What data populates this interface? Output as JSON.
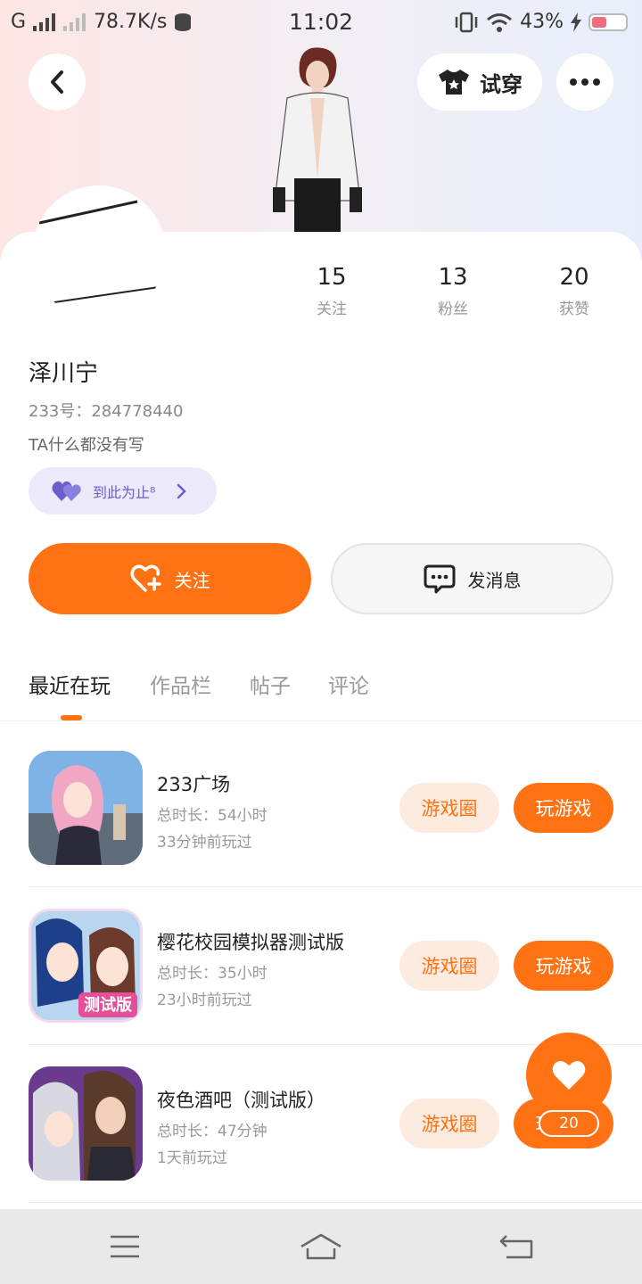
{
  "status_bar": {
    "carrier": "G",
    "net_speed": "78.7K/s",
    "time": "11:02",
    "battery": "43%"
  },
  "header": {
    "back_icon": "chevron-left-icon",
    "try_on_label": "试穿",
    "more_icon": "more-dots-icon"
  },
  "stats": [
    {
      "value": "15",
      "label": "关注"
    },
    {
      "value": "13",
      "label": "粉丝"
    },
    {
      "value": "20",
      "label": "获赞"
    }
  ],
  "profile": {
    "name": "泽川宁",
    "uid": "233号：284778440",
    "bio": "TA什么都没有写",
    "badge_label": "到此为止⁸"
  },
  "actions": {
    "follow_label": "关注",
    "message_label": "发消息"
  },
  "tabs": [
    {
      "label": "最近在玩",
      "active": true
    },
    {
      "label": "作品栏",
      "active": false
    },
    {
      "label": "帖子",
      "active": false
    },
    {
      "label": "评论",
      "active": false
    }
  ],
  "games": [
    {
      "name": "233广场",
      "duration": "总时长：54小时",
      "last_played": "33分钟前玩过",
      "circle_label": "游戏圈",
      "play_label": "玩游戏"
    },
    {
      "name": "樱花校园模拟器测试版",
      "duration": "总时长：35小时",
      "last_played": "23小时前玩过",
      "circle_label": "游戏圈",
      "play_label": "玩游戏"
    },
    {
      "name": "夜色酒吧（测试版）",
      "duration": "总时长：47分钟",
      "last_played": "1天前玩过",
      "circle_label": "游戏圈",
      "play_label": "玩游戏"
    }
  ],
  "icon2_text": "测试版",
  "like_fab": {
    "count": "20"
  },
  "colors": {
    "accent": "#ff7214",
    "badge_bg": "#ece9fb",
    "badge_text": "#6b5fd0"
  }
}
